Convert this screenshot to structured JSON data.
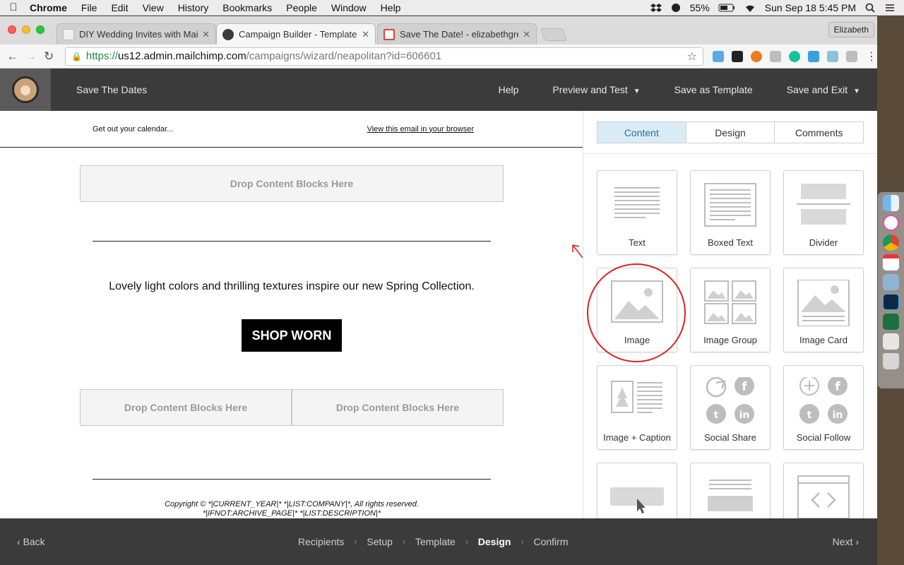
{
  "menubar": {
    "app": "Chrome",
    "items": [
      "File",
      "Edit",
      "View",
      "History",
      "Bookmarks",
      "People",
      "Window",
      "Help"
    ],
    "battery": "55%",
    "clock": "Sun Sep 18  5:45 PM"
  },
  "browser": {
    "tabs": [
      {
        "title": "DIY Wedding Invites with Mailc"
      },
      {
        "title": "Campaign Builder - Template D"
      },
      {
        "title": "Save The Date! - elizabethgree"
      }
    ],
    "profile": "Elizabeth",
    "url": {
      "scheme": "https://",
      "host": "us12.admin.mailchimp.com",
      "path": "/campaigns/wizard/neapolitan?id=606601"
    }
  },
  "header": {
    "title": "Save The Dates",
    "help": "Help",
    "preview": "Preview and Test",
    "save_template": "Save as Template",
    "save_exit": "Save and Exit"
  },
  "email": {
    "preheader_text": "Get out your calendar...",
    "view_in_browser": "View this email in your browser",
    "drop_label": "Drop Content Blocks Here",
    "body_text": "Lovely light colors and thrilling textures inspire our new Spring Collection.",
    "button_label": "SHOP WORN",
    "footer_line1": "Copyright © *|CURRENT_YEAR|* *|LIST:COMPANY|*, All rights reserved.",
    "footer_line2": "*|IFNOT:ARCHIVE_PAGE|* *|LIST:DESCRIPTION|*"
  },
  "panel": {
    "tabs": [
      "Content",
      "Design",
      "Comments"
    ],
    "active_tab": "Content",
    "blocks": [
      {
        "label": "Text",
        "icon": "text-icon"
      },
      {
        "label": "Boxed Text",
        "icon": "boxed-text-icon"
      },
      {
        "label": "Divider",
        "icon": "divider-icon"
      },
      {
        "label": "Image",
        "icon": "image-icon"
      },
      {
        "label": "Image Group",
        "icon": "image-group-icon"
      },
      {
        "label": "Image Card",
        "icon": "image-card-icon"
      },
      {
        "label": "Image + Caption",
        "icon": "image-caption-icon"
      },
      {
        "label": "Social Share",
        "icon": "social-share-icon"
      },
      {
        "label": "Social Follow",
        "icon": "social-follow-icon"
      },
      {
        "label": "",
        "icon": "button-icon"
      },
      {
        "label": "",
        "icon": "footer-icon"
      },
      {
        "label": "",
        "icon": "code-icon"
      }
    ]
  },
  "steps": {
    "back": "Back",
    "items": [
      "Recipients",
      "Setup",
      "Template",
      "Design",
      "Confirm"
    ],
    "active": "Design",
    "next": "Next"
  },
  "colors": {
    "accent_tab": "#d9ecf6",
    "header_bg": "#3b3b3b",
    "annotation": "#dd2222"
  }
}
